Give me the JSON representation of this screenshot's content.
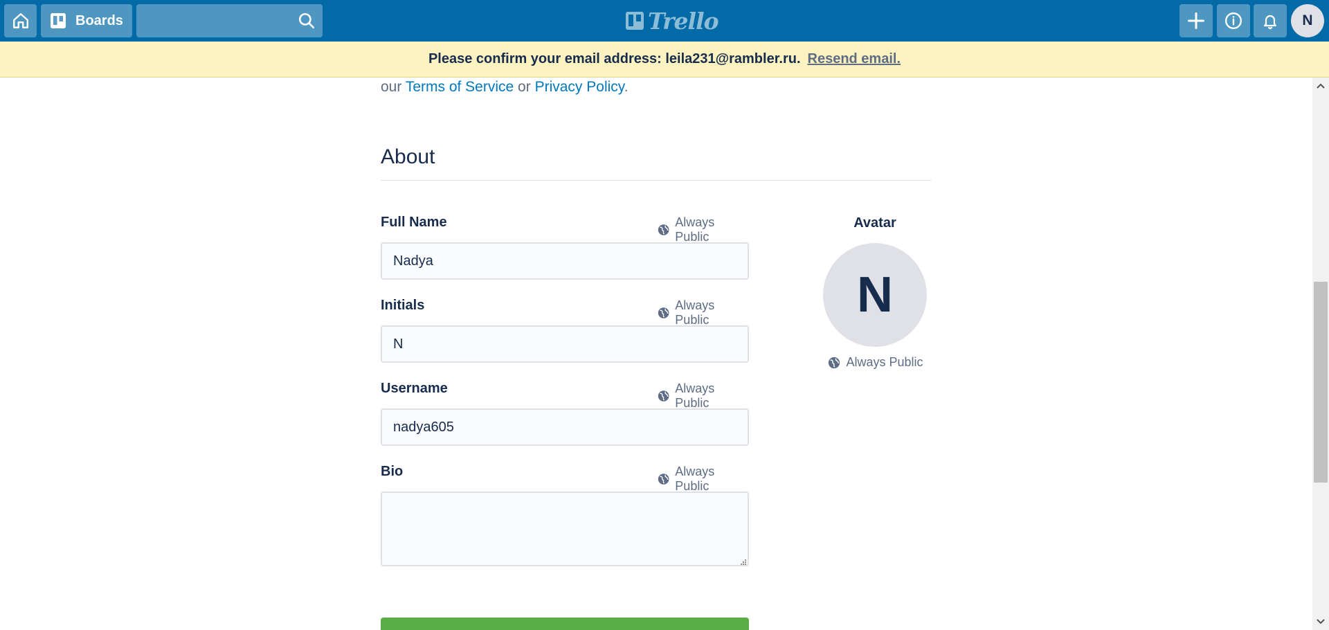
{
  "header": {
    "home_icon": "home-icon",
    "boards_label": "Boards",
    "search_placeholder": "",
    "search_icon": "search-icon",
    "logo_text": "Trello",
    "create_icon": "plus-icon",
    "info_icon": "info-icon",
    "notifications_icon": "bell-icon",
    "avatar_initial": "N"
  },
  "banner": {
    "message": "Please confirm your email address: leila231@rambler.ru.",
    "resend_label": "Resend email."
  },
  "terms": {
    "prefix": "our",
    "terms_link": "Terms of Service",
    "or": "or",
    "privacy_link": "Privacy Policy",
    "suffix": "."
  },
  "about": {
    "title": "About",
    "public_label": "Always Public",
    "full_name": {
      "label": "Full Name",
      "value": "Nadya"
    },
    "initials": {
      "label": "Initials",
      "value": "N"
    },
    "username": {
      "label": "Username",
      "value": "nadya605"
    },
    "bio": {
      "label": "Bio",
      "value": ""
    },
    "avatar": {
      "label": "Avatar",
      "initial": "N",
      "public_label": "Always Public"
    }
  },
  "colors": {
    "header_bg": "#026aa7",
    "banner_bg": "#fcf3c0",
    "link": "#0079bf",
    "save_button": "#5aac44",
    "text": "#172b4d",
    "muted": "#5e6c84"
  }
}
